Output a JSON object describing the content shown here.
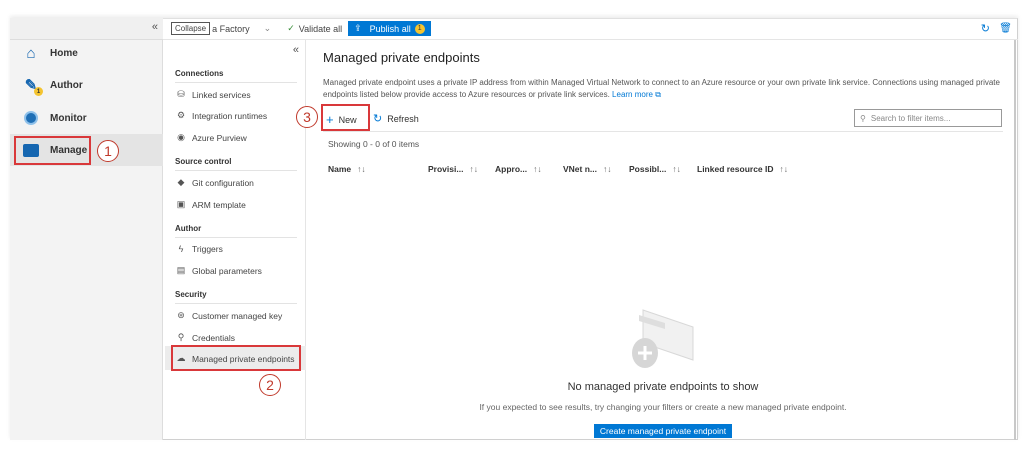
{
  "topbar": {
    "collapse_tooltip": "Collapse",
    "factory_name": "a Factory",
    "validate_all": "Validate all",
    "publish_all": "Publish all",
    "publish_count": "1"
  },
  "leftnav": {
    "collapse": "«",
    "items": [
      {
        "label": "Home",
        "icon": "home-icon"
      },
      {
        "label": "Author",
        "icon": "pencil-icon",
        "badge": "1"
      },
      {
        "label": "Monitor",
        "icon": "gauge-icon"
      },
      {
        "label": "Manage",
        "icon": "toolbox-icon",
        "selected": true
      }
    ]
  },
  "middle": {
    "collapse": "«",
    "sections": [
      {
        "title": "Connections",
        "items": [
          "Linked services",
          "Integration runtimes",
          "Azure Purview"
        ]
      },
      {
        "title": "Source control",
        "items": [
          "Git configuration",
          "ARM template"
        ]
      },
      {
        "title": "Author",
        "items": [
          "Triggers",
          "Global parameters"
        ]
      },
      {
        "title": "Security",
        "items": [
          "Customer managed key",
          "Credentials",
          "Managed private endpoints"
        ]
      }
    ]
  },
  "main": {
    "title": "Managed private endpoints",
    "description": "Managed private endpoint uses a private IP address from within Managed Virtual Network to connect to an Azure resource or your own private link service. Connections using managed private endpoints listed below provide access to Azure resources or private link services.",
    "learn_more": "Learn more",
    "new_label": "New",
    "refresh_label": "Refresh",
    "search_placeholder": "Search to filter items...",
    "showing": "Showing 0 - 0 of 0 items",
    "columns": [
      "Name",
      "Provisi...",
      "Appro...",
      "VNet n...",
      "Possibl...",
      "Linked resource ID"
    ],
    "sort_glyph": "↑↓",
    "empty_title": "No managed private endpoints to show",
    "empty_text": "If you expected to see results, try changing your filters or create a new managed private endpoint.",
    "create_button": "Create managed private endpoint"
  },
  "annotations": [
    "1",
    "2",
    "3"
  ],
  "colors": {
    "accent": "#0078d4",
    "highlight": "#d9383a",
    "nav_bg": "#f3f3f3"
  }
}
